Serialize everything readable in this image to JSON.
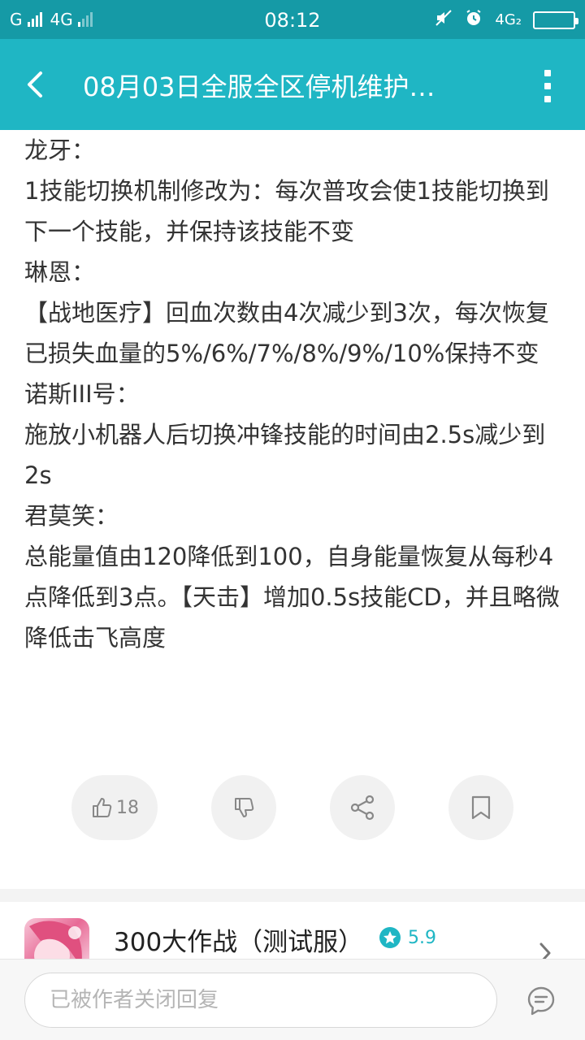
{
  "status_bar": {
    "carrier1": "G",
    "carrier2": "4G",
    "time": "08:12",
    "network_right": "4G₂"
  },
  "header": {
    "title": "08月03日全服全区停机维护…",
    "back_icon": "chevron-left-icon",
    "more_icon": "more-vertical-icon"
  },
  "article": {
    "lines": [
      "龙牙：",
      "1技能切换机制修改为：每次普攻会使1技能切换到下一个技能，并保持该技能不变",
      "琳恩：",
      "【战地医疗】回血次数由4次减少到3次，每次恢复已损失血量的5%/6%/7%/8%/9%/10%保持不变",
      "诺斯III号：",
      "施放小机器人后切换冲锋技能的时间由2.5s减少到2s",
      "君莫笑：",
      "总能量值由120降低到100，自身能量恢复从每秒4点降低到3点。【天击】增加0.5s技能CD，并且略微降低击飞高度"
    ]
  },
  "actions": {
    "like_count": "18",
    "like_icon": "thumbs-up-icon",
    "dislike_icon": "thumbs-down-icon",
    "share_icon": "share-icon",
    "bookmark_icon": "bookmark-icon"
  },
  "game": {
    "name": "300大作战（测试服）",
    "rating": "5.9",
    "rating_icon": "star-icon"
  },
  "reply": {
    "placeholder": "已被作者关闭回复"
  },
  "colors": {
    "status_bar": "#159aa6",
    "app_bar": "#1fb6c4",
    "accent": "#1fb6c4"
  }
}
